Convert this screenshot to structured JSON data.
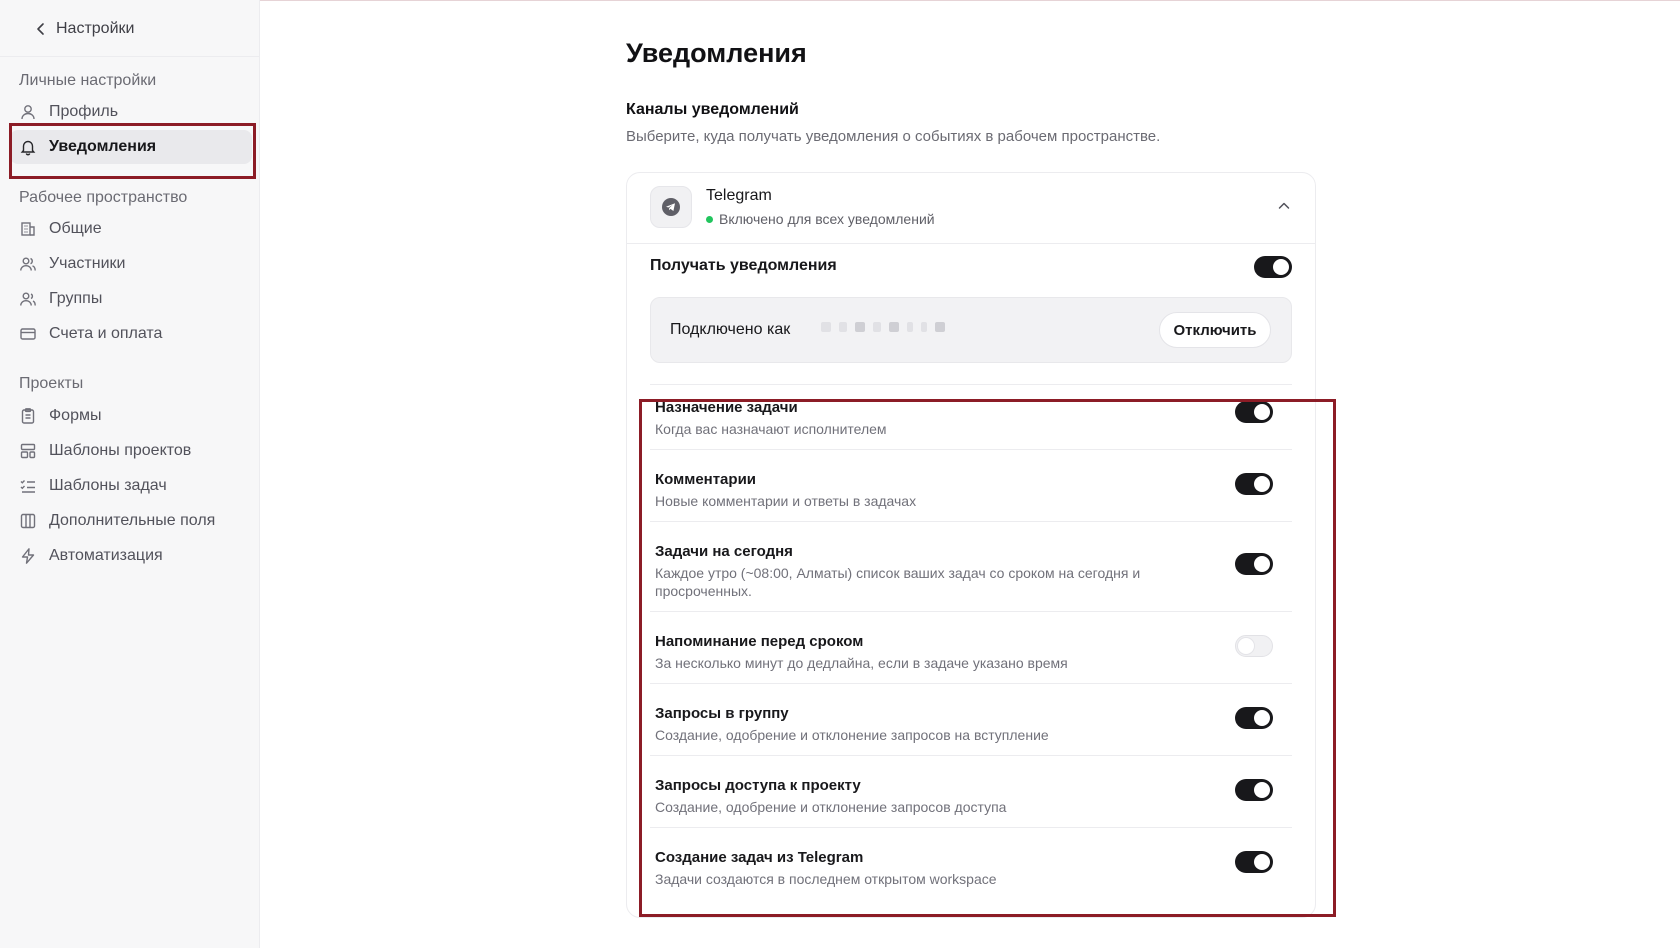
{
  "sidebar": {
    "back_label": "Настройки",
    "groups": [
      {
        "label": "Личные настройки",
        "items": [
          {
            "label": "Профиль",
            "icon": "user-icon"
          },
          {
            "label": "Уведомления",
            "icon": "bell-icon",
            "active": true
          }
        ]
      },
      {
        "label": "Рабочее пространство",
        "items": [
          {
            "label": "Общие",
            "icon": "building-icon"
          },
          {
            "label": "Участники",
            "icon": "users-icon"
          },
          {
            "label": "Группы",
            "icon": "group-icon"
          },
          {
            "label": "Счета и оплата",
            "icon": "credit-card-icon"
          }
        ]
      },
      {
        "label": "Проекты",
        "items": [
          {
            "label": "Формы",
            "icon": "clipboard-icon"
          },
          {
            "label": "Шаблоны проектов",
            "icon": "layout-template-icon"
          },
          {
            "label": "Шаблоны задач",
            "icon": "list-checks-icon"
          },
          {
            "label": "Дополнительные поля",
            "icon": "columns-icon"
          },
          {
            "label": "Автоматизация",
            "icon": "zap-icon"
          }
        ]
      }
    ]
  },
  "main": {
    "title": "Уведомления",
    "section_title": "Каналы уведомлений",
    "section_subtitle": "Выберите, куда получать уведомления о событиях в рабочем пространстве.",
    "channel": {
      "name": "Telegram",
      "status": "Включено для всех уведомлений",
      "status_color": "#22c55e",
      "receive_label": "Получать уведомления",
      "receive_enabled": true,
      "connected_label": "Подключено как",
      "disconnect_label": "Отключить",
      "notifications": [
        {
          "title": "Назначение задачи",
          "description": "Когда вас назначают исполнителем",
          "enabled": true
        },
        {
          "title": "Комментарии",
          "description": "Новые комментарии и ответы в задачах",
          "enabled": true
        },
        {
          "title": "Задачи на сегодня",
          "description": "Каждое утро (~08:00, Алматы) список ваших задач со сроком на сегодня и просроченных.",
          "enabled": true
        },
        {
          "title": "Напоминание перед сроком",
          "description": "За несколько минут до дедлайна, если в задаче указано время",
          "enabled": false
        },
        {
          "title": "Запросы в группу",
          "description": "Создание, одобрение и отклонение запросов на вступление",
          "enabled": true
        },
        {
          "title": "Запросы доступа к проекту",
          "description": "Создание, одобрение и отклонение запросов доступа",
          "enabled": true
        },
        {
          "title": "Создание задач из Telegram",
          "description": "Задачи создаются в последнем открытом workspace",
          "enabled": true
        }
      ]
    }
  },
  "highlight_color": "#8c1c26"
}
